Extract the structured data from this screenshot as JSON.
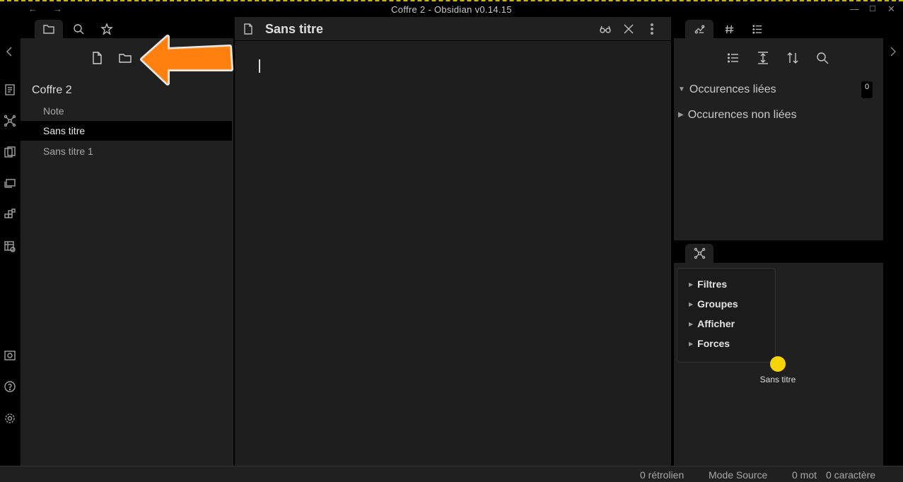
{
  "window": {
    "title": "Coffre 2 - Obsidian v0.14.15"
  },
  "titlebar_icons": [
    "arrow-left-icon",
    "arrow-right-icon",
    "minimize-icon",
    "maximize-icon",
    "close-icon"
  ],
  "left_sidebar": {
    "tabs": [
      "file-explorer-icon",
      "search-icon",
      "star-icon"
    ],
    "actions": [
      "new-note-icon",
      "new-folder-icon"
    ],
    "vault_name": "Coffre 2",
    "files": [
      {
        "name": "Note",
        "active": false
      },
      {
        "name": "Sans titre",
        "active": true
      },
      {
        "name": "Sans titre 1",
        "active": false
      }
    ]
  },
  "editor": {
    "title": "Sans titre",
    "actions": [
      "reading-view-icon",
      "close-icon",
      "more-options-icon"
    ]
  },
  "right_sidebar": {
    "tabs": [
      "backlinks-icon",
      "tags-icon",
      "outline-icon"
    ],
    "actions": [
      "list-icon",
      "expand-icon",
      "sort-icon",
      "search-icon"
    ],
    "linked_mentions": "Occurences liées",
    "linked_count": "0",
    "unlinked_mentions": "Occurences non liées",
    "graph": {
      "tab_icon": "graph-icon",
      "controls": [
        "Filtres",
        "Groupes",
        "Afficher",
        "Forces"
      ],
      "node_label": "Sans titre",
      "node_color": "#f5d400"
    }
  },
  "status_bar": {
    "backlinks": "0 rétrolien",
    "mode": "Mode Source",
    "words": "0 mot",
    "chars": "0 caractère"
  },
  "annotation": {
    "arrow_color": "#ff7f0f"
  }
}
